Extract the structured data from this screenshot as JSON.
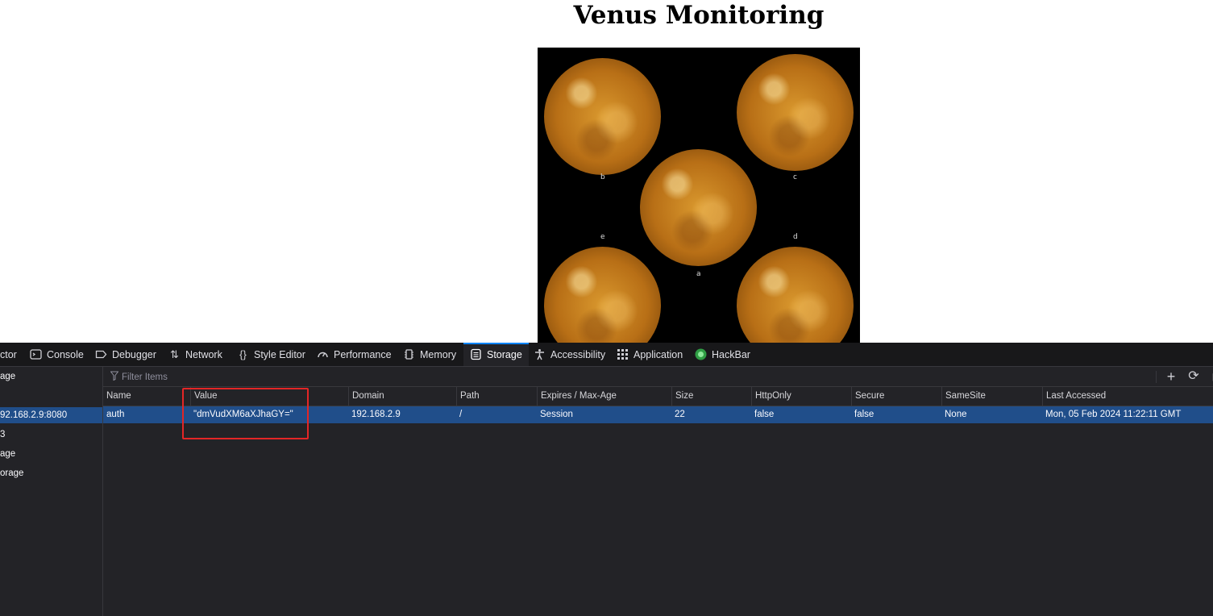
{
  "page": {
    "title": "Venus Monitoring",
    "image": {
      "labels": [
        "b",
        "c",
        "e",
        "d",
        "a"
      ]
    }
  },
  "devtools": {
    "tabs": [
      {
        "label": "ctor",
        "icon": "inspector-icon"
      },
      {
        "label": "Console",
        "icon": "console-icon"
      },
      {
        "label": "Debugger",
        "icon": "debugger-icon"
      },
      {
        "label": "Network",
        "icon": "network-icon"
      },
      {
        "label": "Style Editor",
        "icon": "style-editor-icon"
      },
      {
        "label": "Performance",
        "icon": "performance-icon"
      },
      {
        "label": "Memory",
        "icon": "memory-icon"
      },
      {
        "label": "Storage",
        "icon": "storage-icon",
        "active": true
      },
      {
        "label": "Accessibility",
        "icon": "accessibility-icon"
      },
      {
        "label": "Application",
        "icon": "application-icon"
      },
      {
        "label": "HackBar",
        "icon": "hackbar-icon"
      }
    ],
    "sidebar": {
      "items": [
        "age",
        "92.168.2.9:8080",
        "3",
        "age",
        "orage"
      ]
    },
    "filter": {
      "placeholder": "Filter Items"
    },
    "table": {
      "columns": [
        "Name",
        "Value",
        "Domain",
        "Path",
        "Expires / Max-Age",
        "Size",
        "HttpOnly",
        "Secure",
        "SameSite",
        "Last Accessed"
      ],
      "rows": [
        [
          "auth",
          "\"dmVudXM6aXJhaGY=\"",
          "192.168.2.9",
          "/",
          "Session",
          "22",
          "false",
          "false",
          "None",
          "Mon, 05 Feb 2024 11:22:11 GMT"
        ]
      ]
    },
    "colors": {
      "selected_row": "#204e8a",
      "active_tab_accent": "#0a84ff",
      "annotation_box": "#e32626"
    }
  }
}
